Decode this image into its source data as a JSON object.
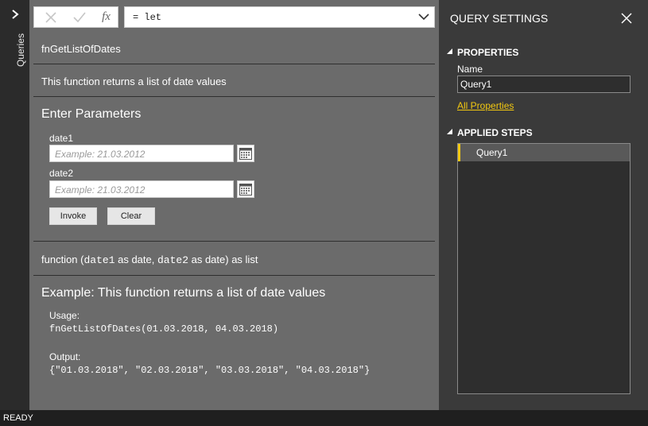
{
  "rail": {
    "label": "Queries",
    "toggle_icon": "chevron-right-icon"
  },
  "formula_bar": {
    "cancel_icon": "x-icon",
    "commit_icon": "check-icon",
    "fx_label": "fx",
    "formula": "= let",
    "dropdown_icon": "chevron-down-icon"
  },
  "function_info": {
    "name": "fnGetListOfDates",
    "description": "This function returns a list of date values"
  },
  "parameters": {
    "title": "Enter Parameters",
    "fields": [
      {
        "label": "date1",
        "placeholder": "Example: 21.03.2012",
        "value": "",
        "picker_icon": "calendar-icon"
      },
      {
        "label": "date2",
        "placeholder": "Example: 21.03.2012",
        "value": "",
        "picker_icon": "calendar-icon"
      }
    ],
    "invoke_label": "Invoke",
    "clear_label": "Clear"
  },
  "signature": {
    "prefix": "function (",
    "p1": "date1",
    "mid1": " as date, ",
    "p2": "date2",
    "suffix": " as date) as list"
  },
  "example": {
    "title": "Example: This function returns a list of date values",
    "usage_label": "Usage:",
    "usage_code": "fnGetListOfDates(01.03.2018, 04.03.2018)",
    "output_label": "Output:",
    "output_code": "{\"01.03.2018\", \"02.03.2018\", \"03.03.2018\", \"04.03.2018\"}"
  },
  "settings": {
    "title": "QUERY SETTINGS",
    "close_icon": "close-icon",
    "properties_header": "PROPERTIES",
    "name_label": "Name",
    "name_value": "Query1",
    "all_properties_link": "All Properties",
    "applied_steps_header": "APPLIED STEPS",
    "steps": [
      "Query1"
    ],
    "accent_color": "#f2c811"
  },
  "status": {
    "text": "READY"
  }
}
